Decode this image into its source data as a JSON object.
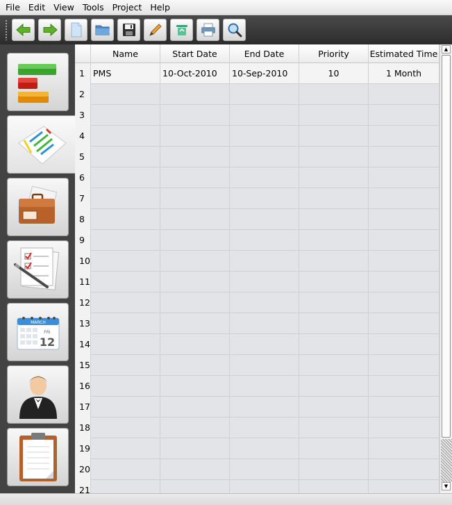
{
  "menu": [
    "File",
    "Edit",
    "View",
    "Tools",
    "Project",
    "Help"
  ],
  "toolbar": {
    "buttons": [
      "back-arrow-icon",
      "forward-arrow-icon",
      "new-document-icon",
      "open-folder-icon",
      "save-floppy-icon",
      "edit-pencil-icon",
      "recycle-icon",
      "print-icon",
      "search-magnifier-icon"
    ]
  },
  "sidebar": {
    "items": [
      "progress-bars-icon",
      "gantt-chart-icon",
      "briefcase-icon",
      "task-checklist-icon",
      "calendar-icon",
      "user-person-icon",
      "clipboard-icon"
    ],
    "active_index": 1,
    "calendar_month": "MARCH",
    "calendar_weekday": "FRI",
    "calendar_day": "12"
  },
  "grid": {
    "columns": [
      "Name",
      "Start Date",
      "End Date",
      "Priority",
      "Estimated Time"
    ],
    "row_numbers": [
      "1",
      "2",
      "3",
      "4",
      "5",
      "6",
      "7",
      "8",
      "9",
      "10",
      "11",
      "12",
      "13",
      "14",
      "15",
      "16",
      "17",
      "18",
      "19",
      "20",
      "21"
    ],
    "rows": [
      [
        "PMS",
        "10-Oct-2010",
        "10-Sep-2010",
        "10",
        "1 Month"
      ]
    ]
  },
  "colors": {
    "toolbar_bg": "#2c2c2c",
    "sidebar_bg": "#434343",
    "grid_bg": "#e3e4e8"
  }
}
